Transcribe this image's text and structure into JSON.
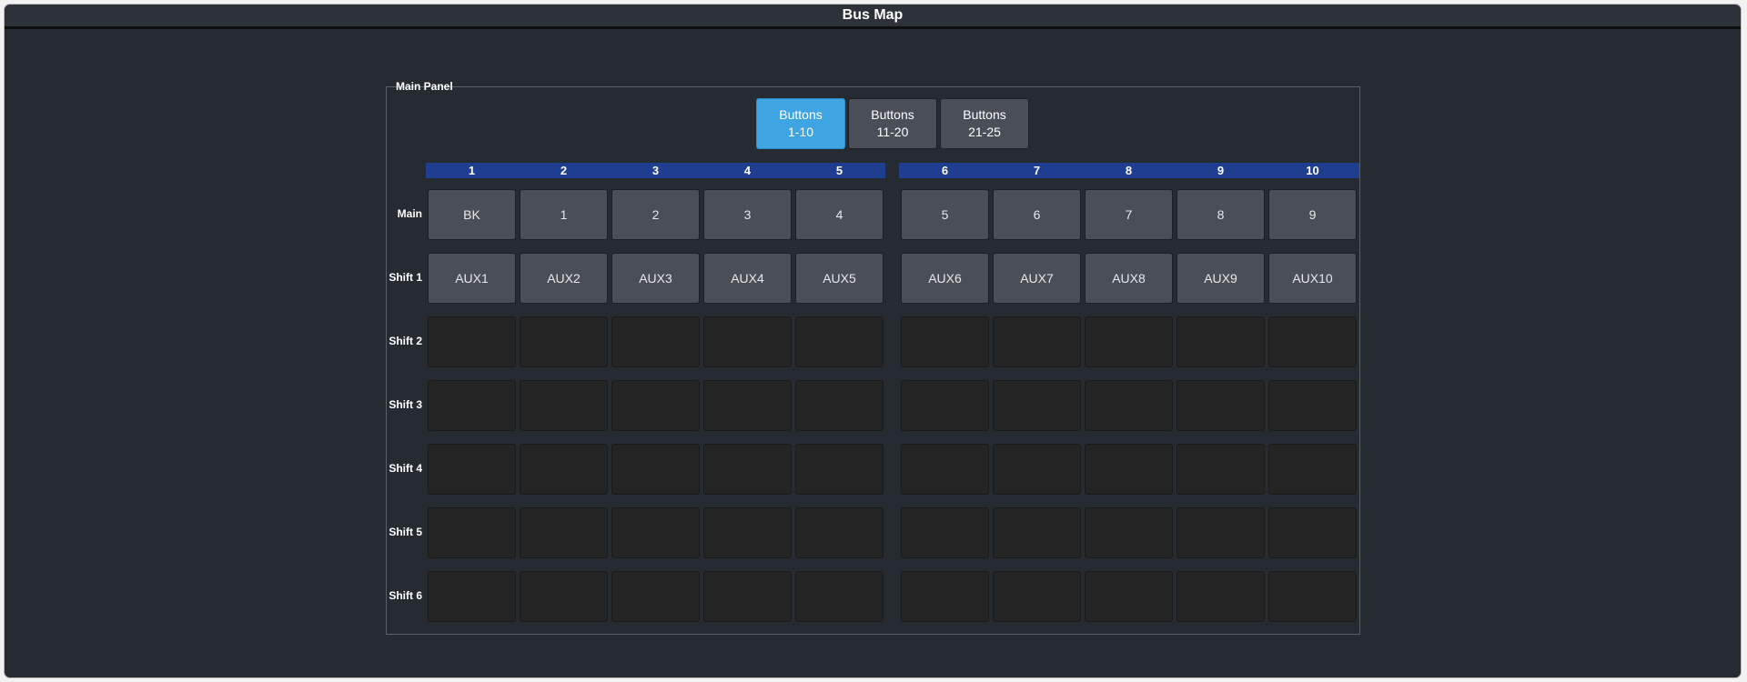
{
  "window": {
    "title": "Bus Map"
  },
  "panel": {
    "legend": "Main Panel"
  },
  "page_buttons": [
    {
      "line1": "Buttons",
      "line2": "1-10",
      "active": true
    },
    {
      "line1": "Buttons",
      "line2": "11-20",
      "active": false
    },
    {
      "line1": "Buttons",
      "line2": "21-25",
      "active": false
    }
  ],
  "columns": [
    "1",
    "2",
    "3",
    "4",
    "5",
    "6",
    "7",
    "8",
    "9",
    "10"
  ],
  "rows": [
    {
      "label": "Main",
      "cells": [
        "BK",
        "1",
        "2",
        "3",
        "4",
        "5",
        "6",
        "7",
        "8",
        "9"
      ]
    },
    {
      "label": "Shift 1",
      "cells": [
        "AUX1",
        "AUX2",
        "AUX3",
        "AUX4",
        "AUX5",
        "AUX6",
        "AUX7",
        "AUX8",
        "AUX9",
        "AUX10"
      ]
    },
    {
      "label": "Shift 2",
      "cells": [
        "",
        "",
        "",
        "",
        "",
        "",
        "",
        "",
        "",
        ""
      ]
    },
    {
      "label": "Shift 3",
      "cells": [
        "",
        "",
        "",
        "",
        "",
        "",
        "",
        "",
        "",
        ""
      ]
    },
    {
      "label": "Shift 4",
      "cells": [
        "",
        "",
        "",
        "",
        "",
        "",
        "",
        "",
        "",
        ""
      ]
    },
    {
      "label": "Shift 5",
      "cells": [
        "",
        "",
        "",
        "",
        "",
        "",
        "",
        "",
        "",
        ""
      ]
    },
    {
      "label": "Shift 6",
      "cells": [
        "",
        "",
        "",
        "",
        "",
        "",
        "",
        "",
        "",
        ""
      ]
    }
  ],
  "colors": {
    "background": "#262a31",
    "header_bar": "#1f3e8f",
    "active_button": "#3fa5e2",
    "filled_cell": "#4a4e57",
    "empty_cell": "#242424"
  }
}
